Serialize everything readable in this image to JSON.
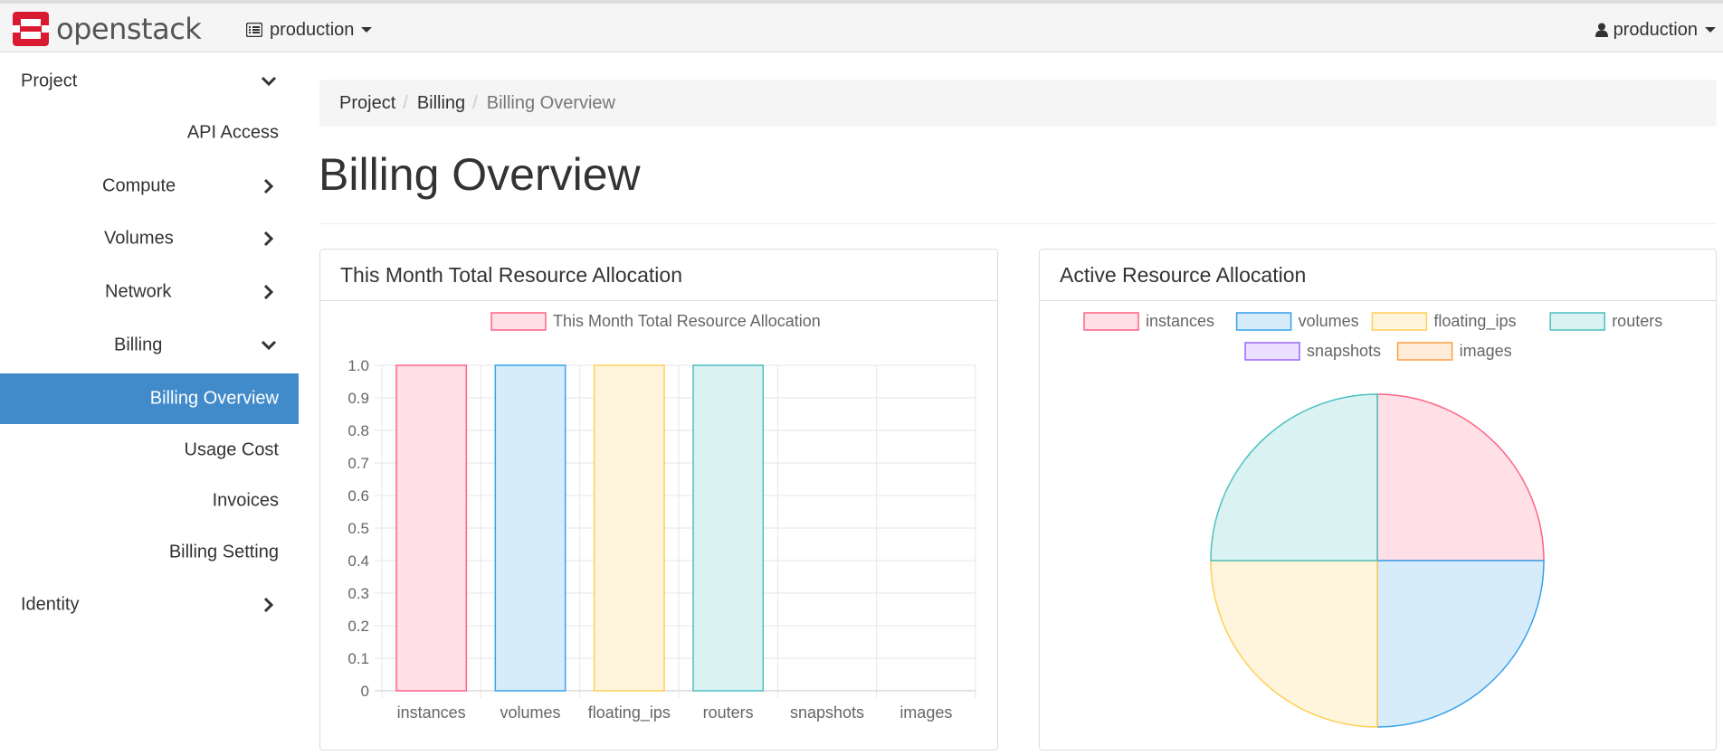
{
  "brand": {
    "name": "openstack"
  },
  "header": {
    "project": "production",
    "user": "production"
  },
  "sidebar": {
    "items": [
      {
        "label": "Project",
        "chevron": "down"
      },
      {
        "label": "API Access"
      },
      {
        "label": "Compute",
        "chevron": "right"
      },
      {
        "label": "Volumes",
        "chevron": "right"
      },
      {
        "label": "Network",
        "chevron": "right"
      },
      {
        "label": "Billing",
        "chevron": "down"
      },
      {
        "label": "Billing Overview",
        "active": true
      },
      {
        "label": "Usage Cost"
      },
      {
        "label": "Invoices"
      },
      {
        "label": "Billing Setting"
      },
      {
        "label": "Identity",
        "chevron": "right"
      }
    ]
  },
  "breadcrumb": {
    "items": [
      "Project",
      "Billing",
      "Billing Overview"
    ]
  },
  "page": {
    "title": "Billing Overview"
  },
  "colors": {
    "accent": "#428bca",
    "brand_red": "#da1a32",
    "series_borders": [
      "#ff6384",
      "#36a2eb",
      "#ffce56",
      "#4bc0c0",
      "#9966ff",
      "#ff9f40"
    ],
    "series_fills": [
      "#ffe0e6",
      "#d7ecfb",
      "#fff5dd",
      "#dbf2f2",
      "#ebe0ff",
      "#ffecd9"
    ]
  },
  "panels": {
    "left_title": "This Month Total Resource Allocation",
    "right_title": "Active Resource Allocation"
  },
  "chart_data": [
    {
      "type": "bar",
      "legend": [
        "This Month Total Resource Allocation"
      ],
      "legend_position": "top",
      "categories": [
        "instances",
        "volumes",
        "floating_ips",
        "routers",
        "snapshots",
        "images"
      ],
      "values": [
        1,
        1,
        1,
        1,
        0,
        0
      ],
      "ylim": [
        0,
        1.0
      ],
      "yticks": [
        "1.0",
        "0.9",
        "0.8",
        "0.7",
        "0.6",
        "0.5",
        "0.4",
        "0.3",
        "0.2",
        "0.1",
        "0"
      ],
      "grid": true
    },
    {
      "type": "pie",
      "legend": [
        "instances",
        "volumes",
        "floating_ips",
        "routers",
        "snapshots",
        "images"
      ],
      "legend_position": "top",
      "values": [
        1,
        1,
        1,
        1,
        0,
        0
      ]
    }
  ]
}
